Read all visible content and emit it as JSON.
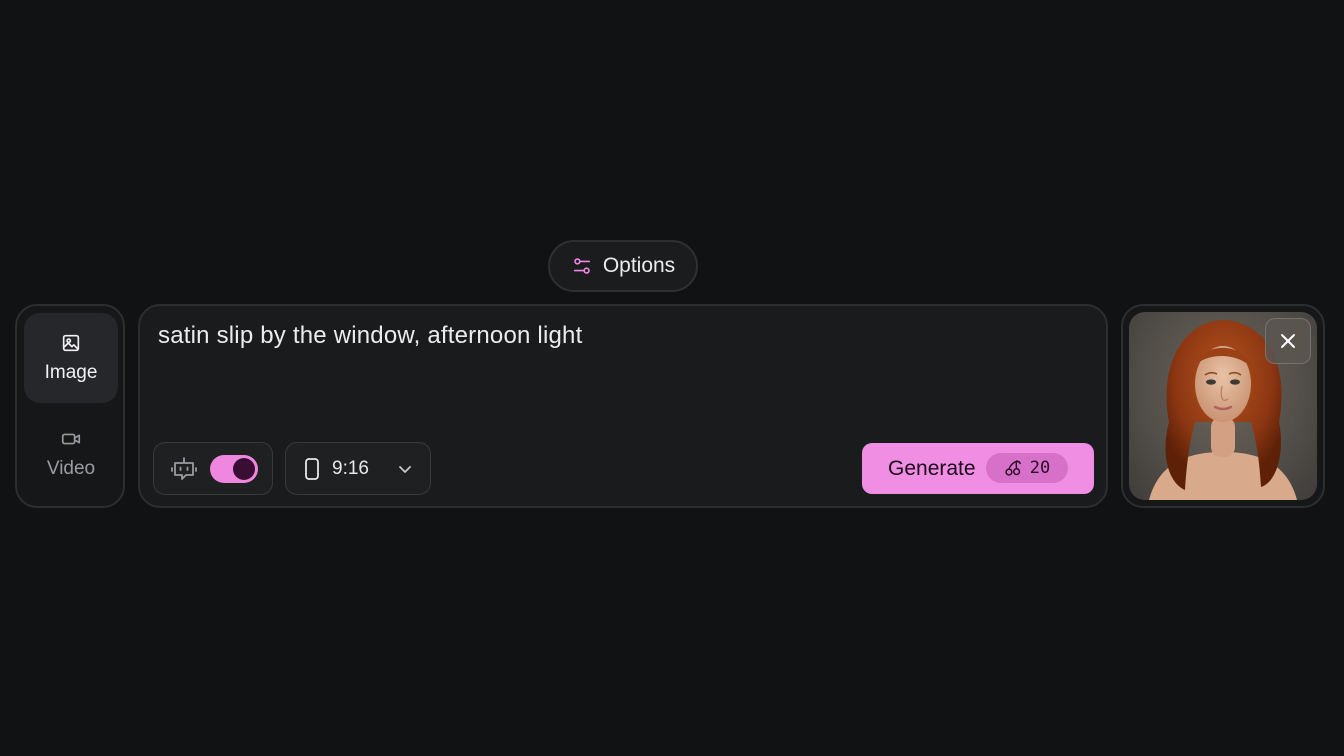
{
  "options": {
    "label": "Options",
    "icon": "sliders-icon"
  },
  "modes": [
    {
      "label": "Image",
      "icon": "image-icon",
      "active": true
    },
    {
      "label": "Video",
      "icon": "video-icon",
      "active": false
    }
  ],
  "prompt": {
    "value": "satin slip by the window, afternoon light"
  },
  "ai_assist": {
    "icon": "robot-icon",
    "enabled": true
  },
  "aspect_ratio": {
    "value": "9:16",
    "icon": "phone-portrait-icon"
  },
  "generate": {
    "label": "Generate",
    "credit_icon": "cherries-icon",
    "credits": "20"
  },
  "reference": {
    "close_icon": "close-icon"
  },
  "colors": {
    "accent": "#f08ee4",
    "background": "#111214",
    "panel": "#1a1b1d"
  }
}
